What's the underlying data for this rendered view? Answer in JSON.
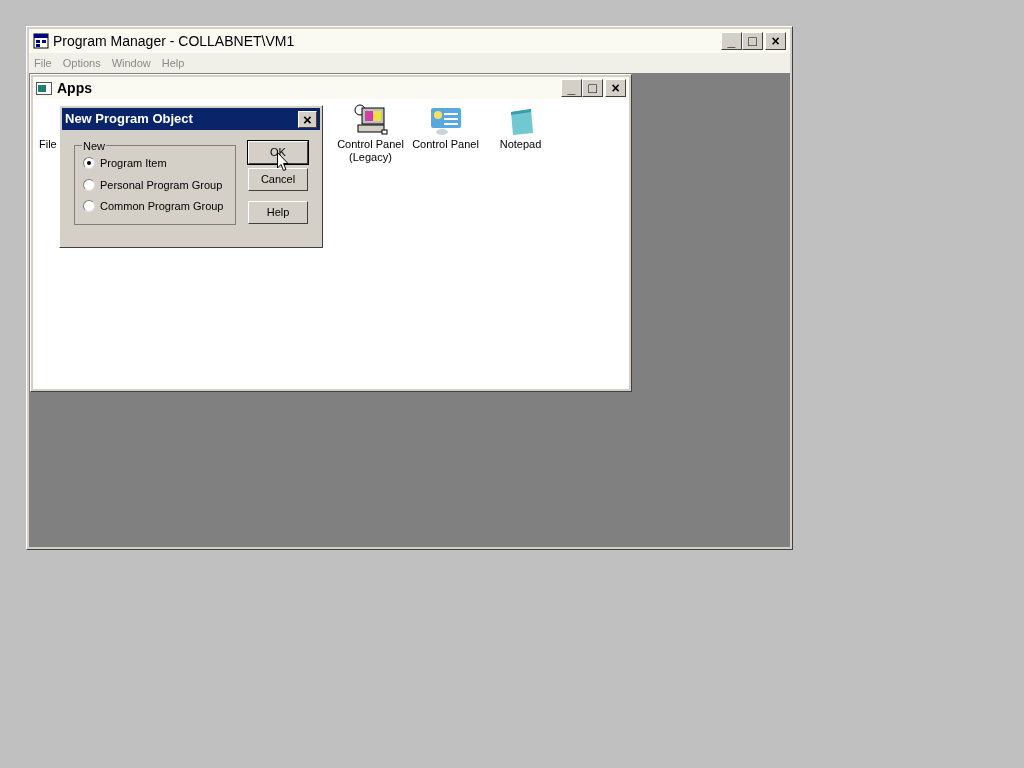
{
  "window": {
    "title": "Program Manager - COLLABNET\\VM1",
    "menu": [
      "File",
      "Options",
      "Window",
      "Help"
    ],
    "controls": [
      "_",
      "□",
      "×"
    ]
  },
  "group_window": {
    "title": "Apps",
    "controls": [
      "_",
      "□",
      "×"
    ],
    "items": [
      {
        "label": "File",
        "kind": "hidden"
      },
      {
        "label": "Control Panel (Legacy)",
        "kind": "legacy"
      },
      {
        "label": "Control Panel",
        "kind": "control"
      },
      {
        "label": "Notepad",
        "kind": "notepad"
      }
    ]
  },
  "dialog": {
    "title": "New Program Object",
    "close": "×",
    "group_label": "New",
    "options": [
      {
        "label": "Program Item",
        "selected": true
      },
      {
        "label": "Personal Program Group",
        "selected": false
      },
      {
        "label": "Common Program Group",
        "selected": false
      }
    ],
    "buttons": [
      {
        "label": "OK",
        "kind": "default"
      },
      {
        "label": "Cancel",
        "kind": "normal"
      },
      {
        "label": "Help",
        "kind": "spaced"
      }
    ]
  }
}
